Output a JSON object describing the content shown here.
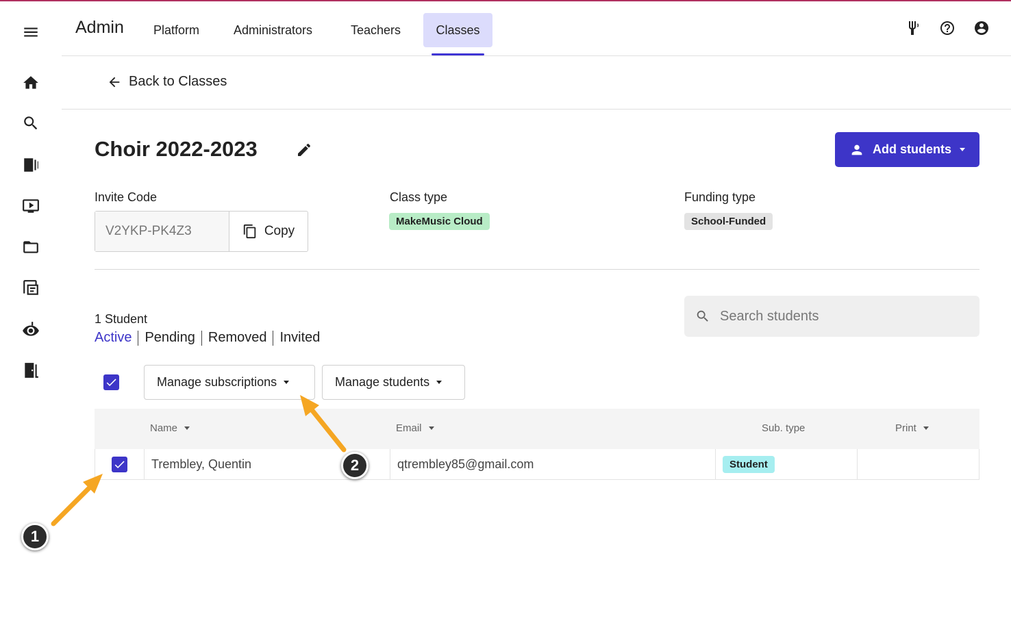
{
  "header": {
    "brand": "Admin",
    "nav": [
      {
        "label": "Platform"
      },
      {
        "label": "Administrators"
      },
      {
        "label": "Teachers"
      },
      {
        "label": "Classes",
        "active": true
      }
    ],
    "icons": [
      "tuning-fork-icon",
      "help-icon",
      "account-icon"
    ]
  },
  "sidebar": {
    "icons": [
      "menu-icon",
      "home-icon",
      "search-icon",
      "library-icon",
      "video-icon",
      "folder-icon",
      "assignment-icon",
      "eye-music-icon",
      "exit-icon"
    ]
  },
  "back": {
    "label": "Back to Classes"
  },
  "class": {
    "title": "Choir 2022-2023",
    "add_students_label": "Add students",
    "invite_label": "Invite Code",
    "invite_code": "V2YKP-PK4Z3",
    "copy_label": "Copy",
    "class_type_label": "Class type",
    "class_type": "MakeMusic Cloud",
    "funding_type_label": "Funding type",
    "funding_type": "School-Funded"
  },
  "colors": {
    "accent": "#3d35c8",
    "class_type_chip": "#b8ecc6",
    "funding_chip": "#e3e3e3",
    "student_chip": "#a6eef0",
    "annotation_arrow": "#f5a623"
  },
  "students": {
    "count_label": "1 Student",
    "filters": [
      "Active",
      "Pending",
      "Removed",
      "Invited"
    ],
    "active_filter": "Active",
    "search_placeholder": "Search students",
    "manage_subscriptions_label": "Manage subscriptions",
    "manage_students_label": "Manage students",
    "columns": {
      "name": "Name",
      "email": "Email",
      "sub_type": "Sub. type",
      "print": "Print"
    },
    "rows": [
      {
        "name": "Trembley, Quentin",
        "email": "qtrembley85@gmail.com",
        "sub_type": "Student",
        "print": "",
        "checked": true
      }
    ],
    "select_all_checked": true
  },
  "annotations": [
    "1",
    "2"
  ]
}
